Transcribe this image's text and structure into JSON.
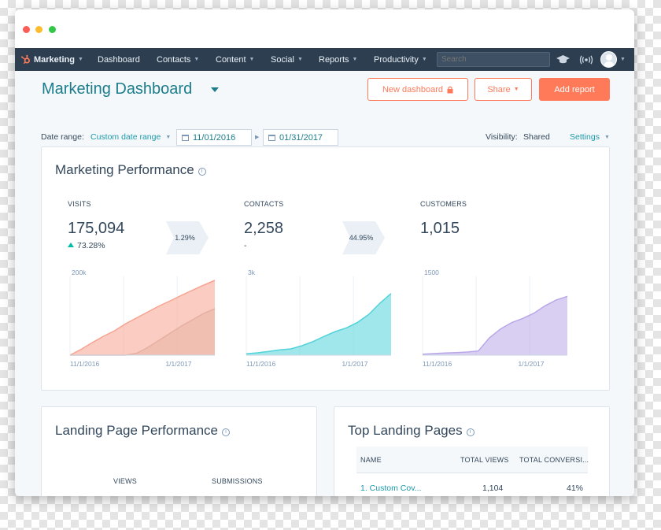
{
  "nav": {
    "items": [
      {
        "label": "Marketing"
      },
      {
        "label": "Dashboard"
      },
      {
        "label": "Contacts"
      },
      {
        "label": "Content"
      },
      {
        "label": "Social"
      },
      {
        "label": "Reports"
      },
      {
        "label": "Productivity"
      }
    ],
    "search_placeholder": "Search",
    "icons": [
      "academy-icon",
      "notifications-icon",
      "avatar"
    ]
  },
  "header": {
    "title": "Marketing Dashboard",
    "buttons": {
      "new_dashboard": "New dashboard",
      "share": "Share",
      "add_report": "Add report"
    }
  },
  "filters": {
    "date_range_label": "Date range:",
    "date_range_value": "Custom date range",
    "start_date": "11/01/2016",
    "end_date": "01/31/2017",
    "visibility_label": "Visibility:",
    "visibility_value": "Shared",
    "settings": "Settings"
  },
  "marketing_performance": {
    "title": "Marketing Performance",
    "metrics": [
      {
        "label": "VISITS",
        "value": "175,094",
        "change": "73.28%",
        "ymax_label": "200k",
        "x_start": "11/1/2016",
        "x_end": "1/1/2017",
        "color": "#f8a28f"
      },
      {
        "label": "CONTACTS",
        "value": "2,258",
        "change": "-",
        "ymax_label": "3k",
        "x_start": "11/1/2016",
        "x_end": "1/1/2017",
        "color": "#51d3d9"
      },
      {
        "label": "CUSTOMERS",
        "value": "1,015",
        "change": "",
        "ymax_label": "1500",
        "x_start": "11/1/2016",
        "x_end": "1/1/2017",
        "color": "#b9a7e8"
      }
    ],
    "conversion_rates": [
      "1.29%",
      "44.95%"
    ]
  },
  "landing_page_performance": {
    "title": "Landing Page Performance",
    "columns": [
      "VIEWS",
      "SUBMISSIONS"
    ]
  },
  "top_landing_pages": {
    "title": "Top Landing Pages",
    "columns": [
      "NAME",
      "TOTAL VIEWS",
      "TOTAL CONVERSI..."
    ],
    "rows": [
      {
        "name": "1. Custom Cov...",
        "views": "1,104",
        "conversion": "41%"
      }
    ]
  },
  "chart_data": [
    {
      "type": "area",
      "title": "",
      "ylim": [
        0,
        200000
      ],
      "x": [
        "11/1/2016",
        "1/1/2017"
      ],
      "series": [
        {
          "values": [
            0,
            15000,
            32000,
            48000,
            62000,
            80000,
            95000,
            110000,
            125000,
            138000,
            152000,
            165000,
            178000,
            190000
          ]
        },
        {
          "values": [
            0,
            0,
            0,
            0,
            0,
            0,
            5000,
            20000,
            38000,
            56000,
            74000,
            90000,
            106000,
            118000
          ]
        }
      ]
    },
    {
      "type": "area",
      "title": "",
      "ylim": [
        0,
        3000
      ],
      "x": [
        "11/1/2016",
        "1/1/2017"
      ],
      "series": [
        {
          "values": [
            50,
            90,
            140,
            200,
            240,
            360,
            520,
            720,
            900,
            1040,
            1250,
            1550,
            1980,
            2350
          ]
        }
      ]
    },
    {
      "type": "area",
      "title": "",
      "ylim": [
        0,
        1500
      ],
      "x": [
        "11/1/2016",
        "1/1/2017"
      ],
      "series": [
        {
          "values": [
            20,
            30,
            40,
            50,
            60,
            80,
            330,
            500,
            620,
            700,
            800,
            940,
            1050,
            1120
          ]
        }
      ]
    }
  ]
}
